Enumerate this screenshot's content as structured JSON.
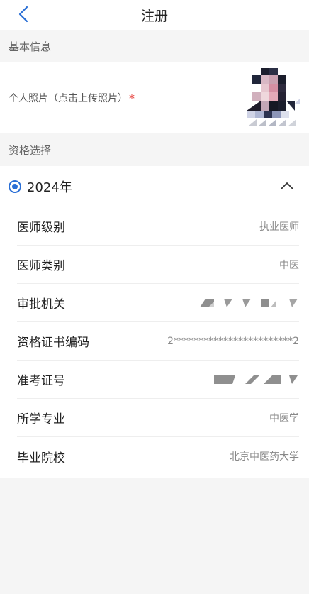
{
  "header": {
    "title": "注册",
    "back_icon": "chevron-left-icon"
  },
  "basic_info": {
    "section_title": "基本信息",
    "photo_label": "个人照片（点击上传照片）",
    "required_mark": "*"
  },
  "qualification": {
    "section_title": "资格选择",
    "year_option": {
      "label": "2024年",
      "selected": true
    },
    "expand_icon": "chevron-up-icon",
    "fields": [
      {
        "label": "医师级别",
        "value": "执业医师"
      },
      {
        "label": "医师类别",
        "value": "中医"
      },
      {
        "label": "审批机关",
        "value": ""
      },
      {
        "label": "资格证书编码",
        "value": "2************************2"
      },
      {
        "label": "准考证号",
        "value": ""
      },
      {
        "label": "所学专业",
        "value": "中医学"
      },
      {
        "label": "毕业院校",
        "value": "北京中医药大学"
      }
    ]
  },
  "colors": {
    "accent": "#2a6fd6",
    "required": "#e53935",
    "background": "#f5f5f5",
    "card": "#ffffff"
  }
}
